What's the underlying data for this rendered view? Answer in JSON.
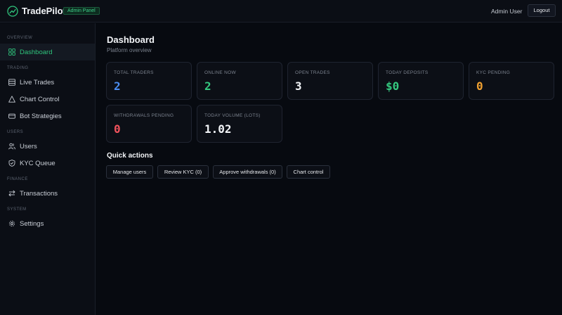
{
  "topbar": {
    "brand": "TradePilot",
    "badge": "Admin Panel",
    "user": "Admin User",
    "logout_label": "Logout"
  },
  "colors": {
    "accent": "#2fc47c",
    "blue": "#4a8cf0",
    "green": "#34c77f",
    "white": "#f2f4f7",
    "orange": "#f0a030",
    "red": "#f0525c"
  },
  "sidebar": {
    "sections": [
      {
        "label": "OVERVIEW",
        "items": [
          {
            "label": "Dashboard",
            "icon": "grid-icon",
            "active": true
          }
        ]
      },
      {
        "label": "TRADING",
        "items": [
          {
            "label": "Live Trades",
            "icon": "list-icon"
          },
          {
            "label": "Chart Control",
            "icon": "triangle-icon"
          },
          {
            "label": "Bot Strategies",
            "icon": "bot-icon"
          }
        ]
      },
      {
        "label": "USERS",
        "items": [
          {
            "label": "Users",
            "icon": "users-icon"
          },
          {
            "label": "KYC Queue",
            "icon": "shield-icon"
          }
        ]
      },
      {
        "label": "FINANCE",
        "items": [
          {
            "label": "Transactions",
            "icon": "transfer-icon"
          }
        ]
      },
      {
        "label": "SYSTEM",
        "items": [
          {
            "label": "Settings",
            "icon": "gear-icon"
          }
        ]
      }
    ]
  },
  "main": {
    "title": "Dashboard",
    "subtitle": "Platform overview",
    "stats": [
      {
        "label": "TOTAL TRADERS",
        "value": "2",
        "color": "blue"
      },
      {
        "label": "ONLINE NOW",
        "value": "2",
        "color": "green"
      },
      {
        "label": "OPEN TRADES",
        "value": "3",
        "color": "white"
      },
      {
        "label": "TODAY DEPOSITS",
        "value": "$0",
        "color": "green"
      },
      {
        "label": "KYC PENDING",
        "value": "0",
        "color": "orange"
      },
      {
        "label": "WITHDRAWALS PENDING",
        "value": "0",
        "color": "red"
      },
      {
        "label": "TODAY VOLUME (LOTS)",
        "value": "1.02",
        "color": "white"
      }
    ],
    "quick_actions_title": "Quick actions",
    "quick_actions": [
      {
        "label": "Manage users"
      },
      {
        "label": "Review KYC (0)"
      },
      {
        "label": "Approve withdrawals (0)"
      },
      {
        "label": "Chart control"
      }
    ]
  }
}
